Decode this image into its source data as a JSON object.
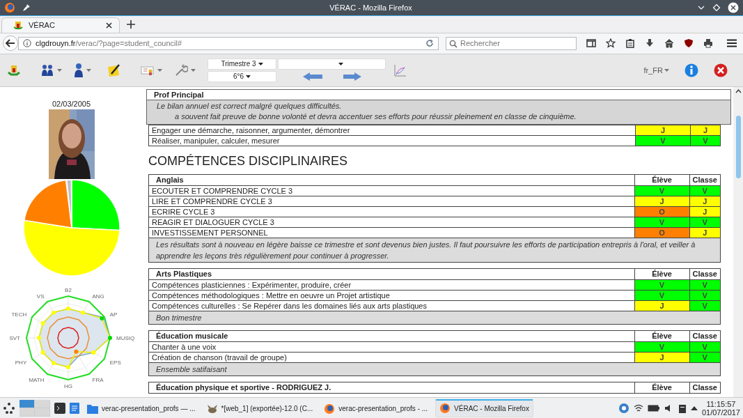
{
  "window": {
    "title": "VÉRAC - Mozilla Firefox"
  },
  "browser": {
    "tab": {
      "title": "VÉRAC"
    },
    "url_host": "clgdrouyn.fr",
    "url_path": "/verac/?page=student_council#",
    "search": {
      "placeholder": "Rechercher"
    }
  },
  "toolbar": {
    "period": "Trimestre 3",
    "class": "6°6",
    "language": "fr_FR"
  },
  "student": {
    "birth_date": "02/03/2005"
  },
  "radar": {
    "axes": [
      {
        "label": "B2",
        "color": "#ffff00"
      },
      {
        "label": "ANG",
        "color": "#ffff00"
      },
      {
        "label": "AP",
        "color": "#00dd00"
      },
      {
        "label": "MUSIQ",
        "color": "#00dd00"
      },
      {
        "label": "EPS",
        "color": "#ffff00"
      },
      {
        "label": "FRA",
        "color": "#ff8000"
      },
      {
        "label": "HG",
        "color": "#ffff00"
      },
      {
        "label": "MATH",
        "color": "#ffff00"
      },
      {
        "label": "PHY",
        "color": "#ffff00"
      },
      {
        "label": "SVT",
        "color": "#ffff00"
      },
      {
        "label": "TECH",
        "color": "#ffff00"
      },
      {
        "label": "VS",
        "color": "#ffff00"
      }
    ]
  },
  "prof_principal": {
    "title": "Prof Principal",
    "lines": [
      "Le bilan annuel est correct malgré quelques difficultés.",
      "a souvent fait preuve de bonne volonté et devra accentuer ses efforts pour réussir pleinement en classe de cinquième."
    ]
  },
  "top_rows": [
    {
      "label": "Engager une démarche, raisonner, argumenter, démontrer",
      "eleve": {
        "text": "J",
        "color": "#ffff00"
      },
      "classe": {
        "text": "J",
        "color": "#ffff00"
      }
    },
    {
      "label": "Réaliser, manipuler, calculer, mesurer",
      "eleve": {
        "text": "V",
        "color": "#00ff00"
      },
      "classe": {
        "text": "V",
        "color": "#00ff00"
      }
    }
  ],
  "section_title": "COMPÉTENCES DISCIPLINAIRES",
  "subjects": [
    {
      "name": "Anglais",
      "columns": [
        "Élève",
        "Classe"
      ],
      "rows": [
        {
          "label": "ECOUTER ET COMPRENDRE CYCLE 3",
          "eleve": {
            "text": "V",
            "color": "#00ff00"
          },
          "classe": {
            "text": "V",
            "color": "#00ff00"
          }
        },
        {
          "label": "LIRE ET COMPRENDRE CYCLE 3",
          "eleve": {
            "text": "J",
            "color": "#ffff00"
          },
          "classe": {
            "text": "J",
            "color": "#ffff00"
          }
        },
        {
          "label": "ECRIRE CYCLE 3",
          "eleve": {
            "text": "O",
            "color": "#ff8000"
          },
          "classe": {
            "text": "J",
            "color": "#ffff00"
          }
        },
        {
          "label": "REAGIR ET DIALOGUER CYCLE 3",
          "eleve": {
            "text": "V",
            "color": "#00ff00"
          },
          "classe": {
            "text": "V",
            "color": "#00ff00"
          }
        },
        {
          "label": "INVESTISSEMENT PERSONNEL",
          "eleve": {
            "text": "O",
            "color": "#ff8000"
          },
          "classe": {
            "text": "J",
            "color": "#ffff00"
          }
        }
      ],
      "comment": "Les résultats sont à nouveau en légère baisse ce trimestre et sont devenus bien justes. Il faut poursuivre les efforts de participation entrepris à l'oral, et veiller à apprendre les leçons très régulièrement pour continuer à progresser."
    },
    {
      "name": "Arts Plastiques",
      "columns": [
        "Élève",
        "Classe"
      ],
      "rows": [
        {
          "label": "Compétences plasticiennes : Expérimenter, produire, créer",
          "eleve": {
            "text": "V",
            "color": "#00ff00"
          },
          "classe": {
            "text": "V",
            "color": "#00ff00"
          }
        },
        {
          "label": "Compétences méthodologiques : Mettre en oeuvre un Projet artistique",
          "eleve": {
            "text": "V",
            "color": "#00ff00"
          },
          "classe": {
            "text": "V",
            "color": "#00ff00"
          }
        },
        {
          "label": "Compétences culturelles : Se Repérer dans les domaines liés aux arts plastiques",
          "eleve": {
            "text": "J",
            "color": "#ffff00"
          },
          "classe": {
            "text": "V",
            "color": "#00ff00"
          }
        }
      ],
      "comment": "Bon trimestre"
    },
    {
      "name": "Éducation musicale",
      "columns": [
        "Élève",
        "Classe"
      ],
      "rows": [
        {
          "label": "Chanter à une voix",
          "eleve": {
            "text": "V",
            "color": "#00ff00"
          },
          "classe": {
            "text": "V",
            "color": "#00ff00"
          }
        },
        {
          "label": "Création de chanson (travail de groupe)",
          "eleve": {
            "text": "J",
            "color": "#ffff00"
          },
          "classe": {
            "text": "V",
            "color": "#00ff00"
          }
        }
      ],
      "comment": "Ensemble satifaisant"
    },
    {
      "name": "Éducation physique et sportive - RODRIGUEZ J.",
      "columns": [
        "Élève",
        "Classe"
      ]
    }
  ],
  "taskbar": {
    "tasks": [
      {
        "label": "verac-presentation_profs — ...",
        "kind": "folder",
        "selected": false
      },
      {
        "label": "*[web_1] (exportée)-12.0 (C...",
        "kind": "gimp",
        "selected": false
      },
      {
        "label": "verac-presentation_profs - ...",
        "kind": "firefox",
        "selected": false
      },
      {
        "label": "VÉRAC - Mozilla Firefox",
        "kind": "firefox",
        "selected": true
      }
    ],
    "time": "11:15:57",
    "date": "01/07/2017"
  }
}
